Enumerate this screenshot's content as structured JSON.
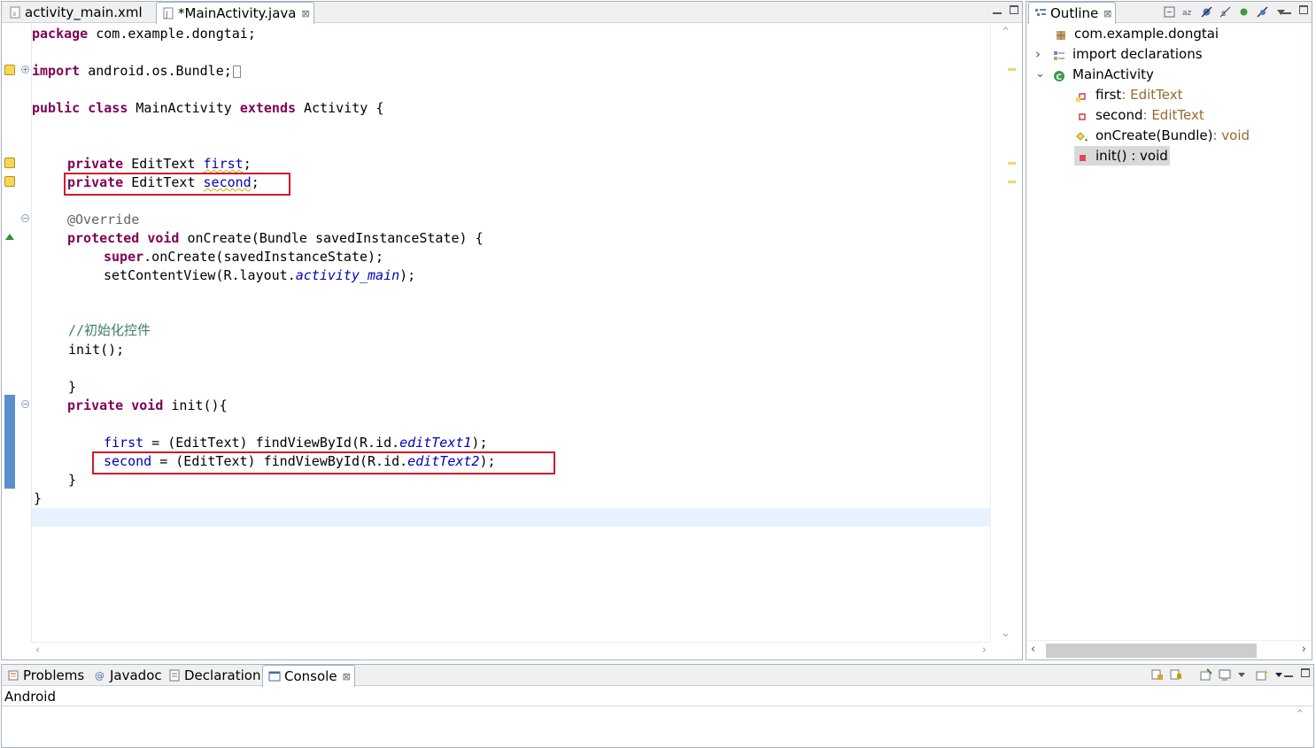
{
  "editor": {
    "tabs": [
      {
        "label": "activity_main.xml",
        "active": false,
        "icon": "xml-file-icon"
      },
      {
        "label": "*MainActivity.java",
        "active": true,
        "icon": "java-file-icon",
        "close": "⊠"
      }
    ]
  },
  "code": {
    "l1": {
      "k1": "package",
      "t1": " com.example.dongtai;"
    },
    "l3": {
      "k1": "import",
      "t1": " android.os.Bundle;"
    },
    "l5": {
      "k1": "public",
      "s1": " ",
      "k2": "class",
      "t1": " MainActivity ",
      "k3": "extends",
      "t2": " Activity {"
    },
    "l8": {
      "k1": "private",
      "t1": " EditText ",
      "f1": "first",
      "t2": ";"
    },
    "l9": {
      "k1": "private",
      "t1": " EditText ",
      "f1": "second",
      "t2": ";"
    },
    "l11": {
      "a1": "@Override"
    },
    "l12": {
      "k1": "protected",
      "s1": " ",
      "k2": "void",
      "t1": " onCreate(Bundle savedInstanceState) {"
    },
    "l13": {
      "k1": "super",
      "t1": ".onCreate(savedInstanceState);"
    },
    "l14": {
      "t1": "setContentView(R.layout.",
      "i1": "activity_main",
      "t2": ");"
    },
    "l17": {
      "c1": "//初始化控件"
    },
    "l18": {
      "t1": "init();"
    },
    "l20": {
      "t1": "}"
    },
    "l21": {
      "k1": "private",
      "s1": " ",
      "k2": "void",
      "t1": " init(){"
    },
    "l23": {
      "f1": "first",
      "t1": " = (EditText) findViewById(R.id.",
      "i1": "editText1",
      "t2": ");"
    },
    "l24": {
      "f1": "second",
      "t1": " = (EditText) findViewById(R.id.",
      "i1": "editText2",
      "t2": ");"
    },
    "l25": {
      "t1": "}"
    },
    "l26": {
      "t1": "}"
    }
  },
  "outline": {
    "tab_label": "Outline",
    "close": "⊠",
    "items": [
      {
        "label": "com.example.dongtai",
        "type": "",
        "icon": "package-icon"
      },
      {
        "label": "import declarations",
        "type": "",
        "icon": "imports-icon",
        "expander": "›"
      },
      {
        "label": "MainActivity",
        "type": "",
        "icon": "class-icon",
        "expander": "⌄"
      },
      {
        "label": "first",
        "type": " : EditText",
        "icon": "private-field-icon"
      },
      {
        "label": "second",
        "type": " : EditText",
        "icon": "private-field-icon"
      },
      {
        "label": "onCreate(Bundle)",
        "type": " : void",
        "icon": "protected-method-icon"
      },
      {
        "label": "init() : void",
        "type": "",
        "icon": "private-method-icon",
        "selected": true
      }
    ]
  },
  "console": {
    "tabs": [
      {
        "label": "Problems",
        "icon": "problems-icon"
      },
      {
        "label": "Javadoc",
        "icon": "javadoc-icon"
      },
      {
        "label": "Declaration",
        "icon": "declaration-icon"
      },
      {
        "label": "Console",
        "icon": "console-icon",
        "active": true,
        "close": "⊠"
      }
    ],
    "title": "Android"
  },
  "colors": {
    "keyword": "#7f0055",
    "field": "#0000c0",
    "annotation": "#646464",
    "comment": "#3f7f5f",
    "highlight_box": "#d11a2a",
    "current_line": "#e8f2fe"
  }
}
